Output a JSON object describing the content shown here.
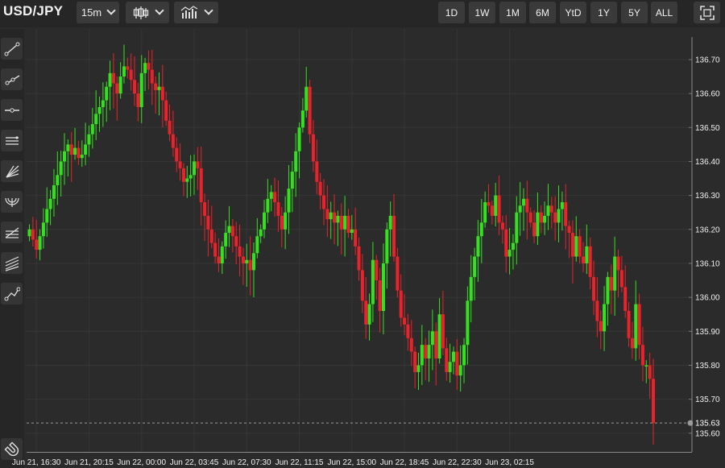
{
  "header": {
    "symbol": "USD/JPY",
    "interval_label": "15m",
    "chart_style_icon": "candlestick-icon",
    "indicators_icon": "indicators-icon",
    "ranges": [
      "1D",
      "1W",
      "1M",
      "6M",
      "YtD",
      "1Y",
      "5Y",
      "ALL"
    ],
    "fullscreen_icon": "fullscreen-icon"
  },
  "toolbar": {
    "tools": [
      "trend-line-icon",
      "ray-icon",
      "horizontal-line-icon",
      "parallel-channel-icon",
      "fan-icon",
      "arc-icon",
      "fib-retracement-icon",
      "fib-channel-icon",
      "path-icon"
    ],
    "magnet_icon": "magnet-icon"
  },
  "colors": {
    "up": "#35e01f",
    "down": "#e8232b",
    "background": "#2b2b2b",
    "grid": "#363636"
  },
  "chart_data": {
    "type": "candlestick",
    "title": "",
    "ylim": [
      135.545,
      136.79
    ],
    "y_ticks": [
      "136.70",
      "136.60",
      "136.50",
      "136.40",
      "136.30",
      "136.20",
      "136.10",
      "136.00",
      "135.90",
      "135.80",
      "135.70",
      "135.60"
    ],
    "x_tick_labels": [
      "Jun 21, 16:30",
      "Jun 21, 20:15",
      "Jun 22, 00:00",
      "Jun 22, 03:45",
      "Jun 22, 07:30",
      "Jun 22, 11:15",
      "Jun 22, 15:00",
      "Jun 22, 18:45",
      "Jun 22, 22:30",
      "Jun 23, 02:15"
    ],
    "interval_minutes": 15,
    "grid": true,
    "current_price": "135.63",
    "close_series": [
      136.2,
      136.17,
      136.14,
      136.18,
      136.22,
      136.26,
      136.29,
      136.33,
      136.36,
      136.4,
      136.43,
      136.45,
      136.42,
      136.44,
      136.41,
      136.42,
      136.45,
      136.48,
      136.51,
      136.54,
      136.56,
      136.58,
      136.62,
      136.66,
      136.63,
      136.6,
      136.65,
      136.68,
      136.67,
      136.64,
      136.6,
      136.56,
      136.66,
      136.69,
      136.67,
      136.63,
      136.61,
      136.62,
      136.58,
      136.52,
      136.48,
      136.44,
      136.4,
      136.38,
      136.34,
      136.35,
      136.36,
      136.4,
      136.38,
      136.28,
      136.24,
      136.2,
      136.16,
      136.12,
      136.1,
      136.15,
      136.19,
      136.21,
      136.18,
      136.15,
      136.12,
      136.1,
      136.11,
      136.08,
      136.13,
      136.18,
      136.2,
      136.25,
      136.29,
      136.31,
      136.28,
      136.24,
      136.2,
      136.25,
      136.32,
      136.37,
      136.43,
      136.5,
      136.55,
      136.62,
      136.48,
      136.4,
      136.34,
      136.3,
      136.26,
      136.23,
      136.25,
      136.22,
      136.24,
      136.2,
      136.24,
      136.19,
      136.2,
      136.15,
      136.08,
      135.99,
      135.92,
      135.98,
      136.11,
      136.05,
      135.96,
      136.1,
      136.2,
      136.24,
      136.12,
      136.02,
      135.94,
      135.92,
      135.88,
      135.84,
      135.78,
      135.8,
      135.86,
      135.82,
      135.86,
      135.9,
      135.82,
      135.95,
      135.85,
      135.78,
      135.81,
      135.84,
      135.77,
      135.8,
      135.86,
      135.99,
      136.06,
      136.12,
      136.18,
      136.22,
      136.28,
      136.27,
      136.24,
      136.3,
      136.22,
      136.2,
      136.12,
      136.14,
      136.16,
      136.25,
      136.27,
      136.29,
      136.25,
      136.22,
      136.18,
      136.25,
      136.22,
      136.24,
      136.27,
      136.25,
      136.22,
      136.26,
      136.28,
      136.21,
      136.19,
      136.12,
      136.18,
      136.12,
      136.1,
      136.15,
      136.06,
      135.99,
      135.93,
      135.9,
      135.98,
      136.06,
      136.02,
      136.12,
      136.08,
      136.03,
      135.96,
      135.88,
      135.85,
      135.98,
      135.86,
      135.8,
      135.8,
      135.76,
      135.63
    ]
  }
}
